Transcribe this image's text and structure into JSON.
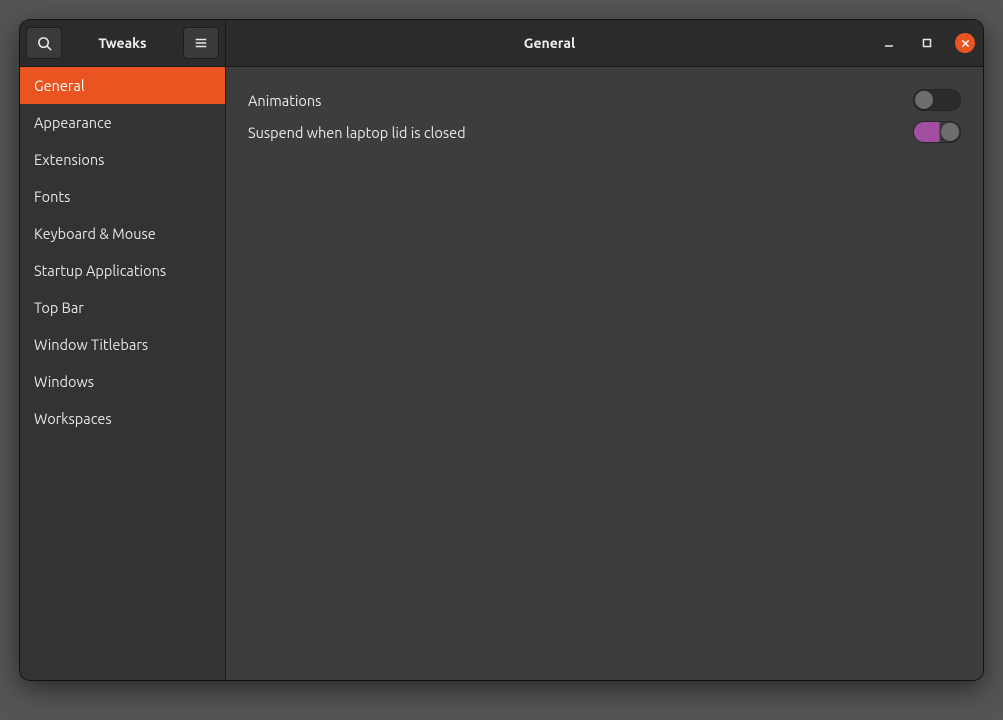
{
  "header": {
    "app_title": "Tweaks",
    "page_title": "General"
  },
  "sidebar": {
    "items": [
      {
        "label": "General",
        "active": true
      },
      {
        "label": "Appearance",
        "active": false
      },
      {
        "label": "Extensions",
        "active": false
      },
      {
        "label": "Fonts",
        "active": false
      },
      {
        "label": "Keyboard & Mouse",
        "active": false
      },
      {
        "label": "Startup Applications",
        "active": false
      },
      {
        "label": "Top Bar",
        "active": false
      },
      {
        "label": "Window Titlebars",
        "active": false
      },
      {
        "label": "Windows",
        "active": false
      },
      {
        "label": "Workspaces",
        "active": false
      }
    ]
  },
  "settings": {
    "rows": [
      {
        "label": "Animations",
        "value": false
      },
      {
        "label": "Suspend when laptop lid is closed",
        "value": true
      }
    ]
  },
  "colors": {
    "accent": "#e95420",
    "switch_on": "#a24fa2"
  }
}
